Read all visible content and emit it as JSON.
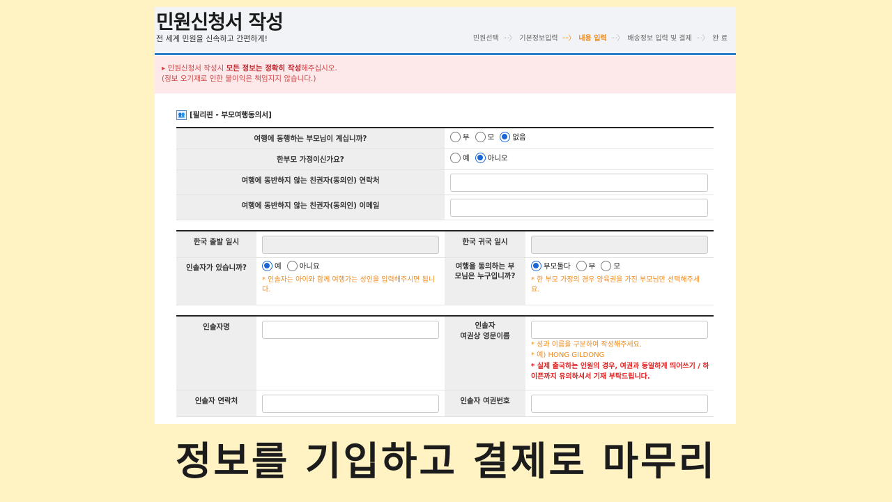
{
  "header": {
    "title": "민원신청서 작성",
    "subtitle": "전 세계 민원을 신속하고 간편하게!",
    "steps": [
      "민원선택",
      "기본정보입력",
      "내용 입력",
      "배송정보 입력 및 결제",
      "완 료"
    ],
    "active_step_index": 2,
    "accent_color": "#2d7ec6",
    "active_step_color": "#f08a1c"
  },
  "notice": {
    "line1_prefix": "▸ 민원신청서 작성시 ",
    "line1_bold": "모든 정보는 정확히 작성",
    "line1_suffix": "해주십시오.",
    "line2": "(정보 오기재로 인한 불이익은 책임지지 않습니다.)"
  },
  "section": {
    "icon": "people-icon",
    "title": "[필리핀 - 부모여행동의서]"
  },
  "table1": {
    "parent_q": {
      "label": "여행에 동행하는 부모님이 계십니까?",
      "options": [
        "부",
        "모",
        "없음"
      ],
      "selected": "없음"
    },
    "single_q": {
      "label": "한부모 가정이신가요?",
      "options": [
        "예",
        "아니오"
      ],
      "selected": "아니오"
    },
    "guardian_phone_label": "여행에 동반하지 않는 친권자(동의인) 연락처",
    "guardian_email_label": "여행에 동반하지 않는 친권자(동의인) 이메일"
  },
  "table2": {
    "departure_label": "한국 출발 일시",
    "return_label": "한국 귀국 일시",
    "escort_q": {
      "label": "인솔자가 있습니까?",
      "options": [
        "예",
        "아니요"
      ],
      "selected": "예",
      "note": "* 인솔자는 아이와 함께 여행가는 성인을 입력해주시면 됩니다."
    },
    "consent_q": {
      "label": "여행을 동의하는 부모님은 누구입니까?",
      "options": [
        "부모둘다",
        "부",
        "모"
      ],
      "selected": "부모둘다",
      "note": "* 한 부모 가정의 경우 양육권을 가진 부모님만 선택해주세요."
    }
  },
  "table3": {
    "escort_name_label": "인솔자명",
    "escort_eng_label_1": "인솔자",
    "escort_eng_label_2": "여권상 영문이름",
    "note1": "* 성과 이름을 구분하여 작성해주세요.",
    "note2": "* 예) HONG GILDONG",
    "note3": "* 실제 출국하는 인원의 경우, 여권과 동일하게 띄어쓰기 / 하이픈까지 유의하셔서 기재 부탁드립니다.",
    "escort_phone_label": "인솔자 연락처",
    "escort_passport_label": "인솔자 여권번호"
  },
  "caption": "정보를 기입하고 결제로 마무리"
}
